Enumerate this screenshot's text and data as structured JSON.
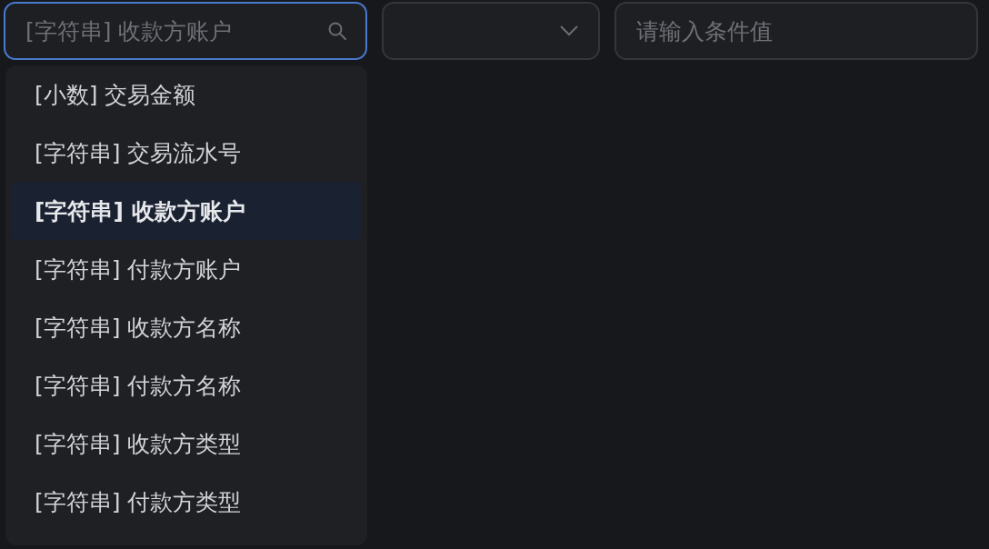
{
  "field_search": {
    "placeholder": "[字符串] 收款方账户",
    "focused": true
  },
  "operator_select": {
    "expanded": false
  },
  "value_input": {
    "placeholder": "请输入条件值"
  },
  "dropdown": {
    "items": [
      {
        "label": "[小数] 交易金额",
        "selected": false
      },
      {
        "label": "[字符串] 交易流水号",
        "selected": false
      },
      {
        "label": "[字符串] 收款方账户",
        "selected": true
      },
      {
        "label": "[字符串] 付款方账户",
        "selected": false
      },
      {
        "label": "[字符串] 收款方名称",
        "selected": false
      },
      {
        "label": "[字符串] 付款方名称",
        "selected": false
      },
      {
        "label": "[字符串] 收款方类型",
        "selected": false
      },
      {
        "label": "[字符串] 付款方类型",
        "selected": false
      }
    ]
  }
}
